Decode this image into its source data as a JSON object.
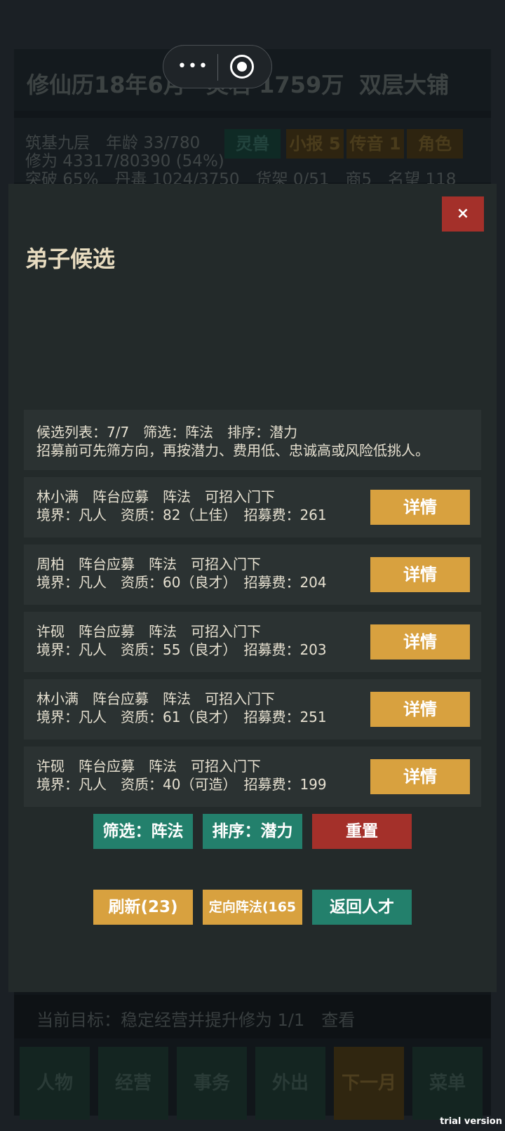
{
  "header": {
    "date": "修仙历18年6月",
    "spirit_stones": "灵石 1759万",
    "shop": "双层大铺"
  },
  "stats": {
    "line1": "筑基九层　年龄 33/780",
    "line2": "修为 43317/80390 (54%)",
    "line3": "突破 65%　丹毒 1024/3750　货架 0/51　商5　名望 118",
    "chips": [
      "灵兽",
      "小报 5",
      "传音 1",
      "角色"
    ]
  },
  "modal": {
    "close": "×",
    "title": "弟子候选",
    "info_line1": "候选列表：7/7　筛选：阵法　排序：潜力",
    "info_line2": "招募前可先筛方向，再按潜力、费用低、忠诚高或风险低挑人。",
    "candidates": [
      {
        "line1": "林小满　阵台应募　阵法　可招入门下",
        "line2": "境界：凡人　资质：82（上佳）　招募费：261",
        "button": "详情"
      },
      {
        "line1": "周柏　阵台应募　阵法　可招入门下",
        "line2": "境界：凡人　资质：60（良才）　招募费：204",
        "button": "详情"
      },
      {
        "line1": "许砚　阵台应募　阵法　可招入门下",
        "line2": "境界：凡人　资质：55（良才）　招募费：203",
        "button": "详情"
      },
      {
        "line1": "林小满　阵台应募　阵法　可招入门下",
        "line2": "境界：凡人　资质：61（良才）　招募费：251",
        "button": "详情"
      },
      {
        "line1": "许砚　阵台应募　阵法　可招入门下",
        "line2": "境界：凡人　资质：40（可造）　招募费：199",
        "button": "详情"
      }
    ],
    "filter_btn": "筛选：阵法",
    "sort_btn": "排序：潜力",
    "reset_btn": "重置",
    "refresh_btn": "刷新(23)",
    "target_btn": "定向阵法(165",
    "back_btn": "返回人才"
  },
  "goal": "当前目标：稳定经营并提升修为 1/1　查看",
  "nav": [
    "人物",
    "经营",
    "事务",
    "外出",
    "下一月",
    "菜单"
  ],
  "watermark": "trial version",
  "colors": {
    "teal": "#23806c",
    "amber": "#d8a13f",
    "red": "#a4302a",
    "panel": "#232a2a"
  }
}
